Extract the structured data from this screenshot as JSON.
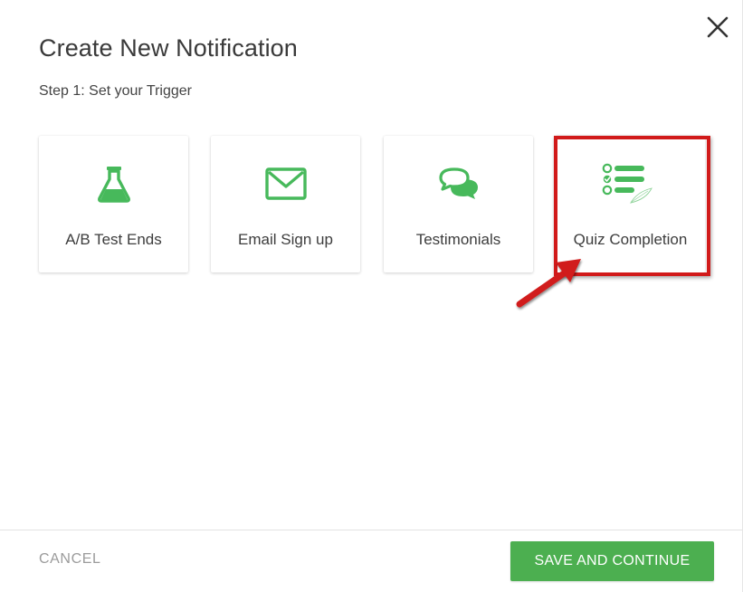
{
  "dialog": {
    "title": "Create New Notification",
    "step_label": "Step 1: Set your Trigger"
  },
  "triggers": [
    {
      "label": "A/B Test Ends",
      "icon": "flask-icon"
    },
    {
      "label": "Email Sign up",
      "icon": "envelope-icon"
    },
    {
      "label": "Testimonials",
      "icon": "chat-bubbles-icon"
    },
    {
      "label": "Quiz Completion",
      "icon": "checklist-icon"
    }
  ],
  "footer": {
    "cancel_label": "CANCEL",
    "save_label": "SAVE AND CONTINUE"
  },
  "colors": {
    "accent_green": "#4caf50",
    "icon_green": "#47b95b",
    "highlight_red": "#d11a1a"
  },
  "icons": {
    "close": "close-icon"
  }
}
